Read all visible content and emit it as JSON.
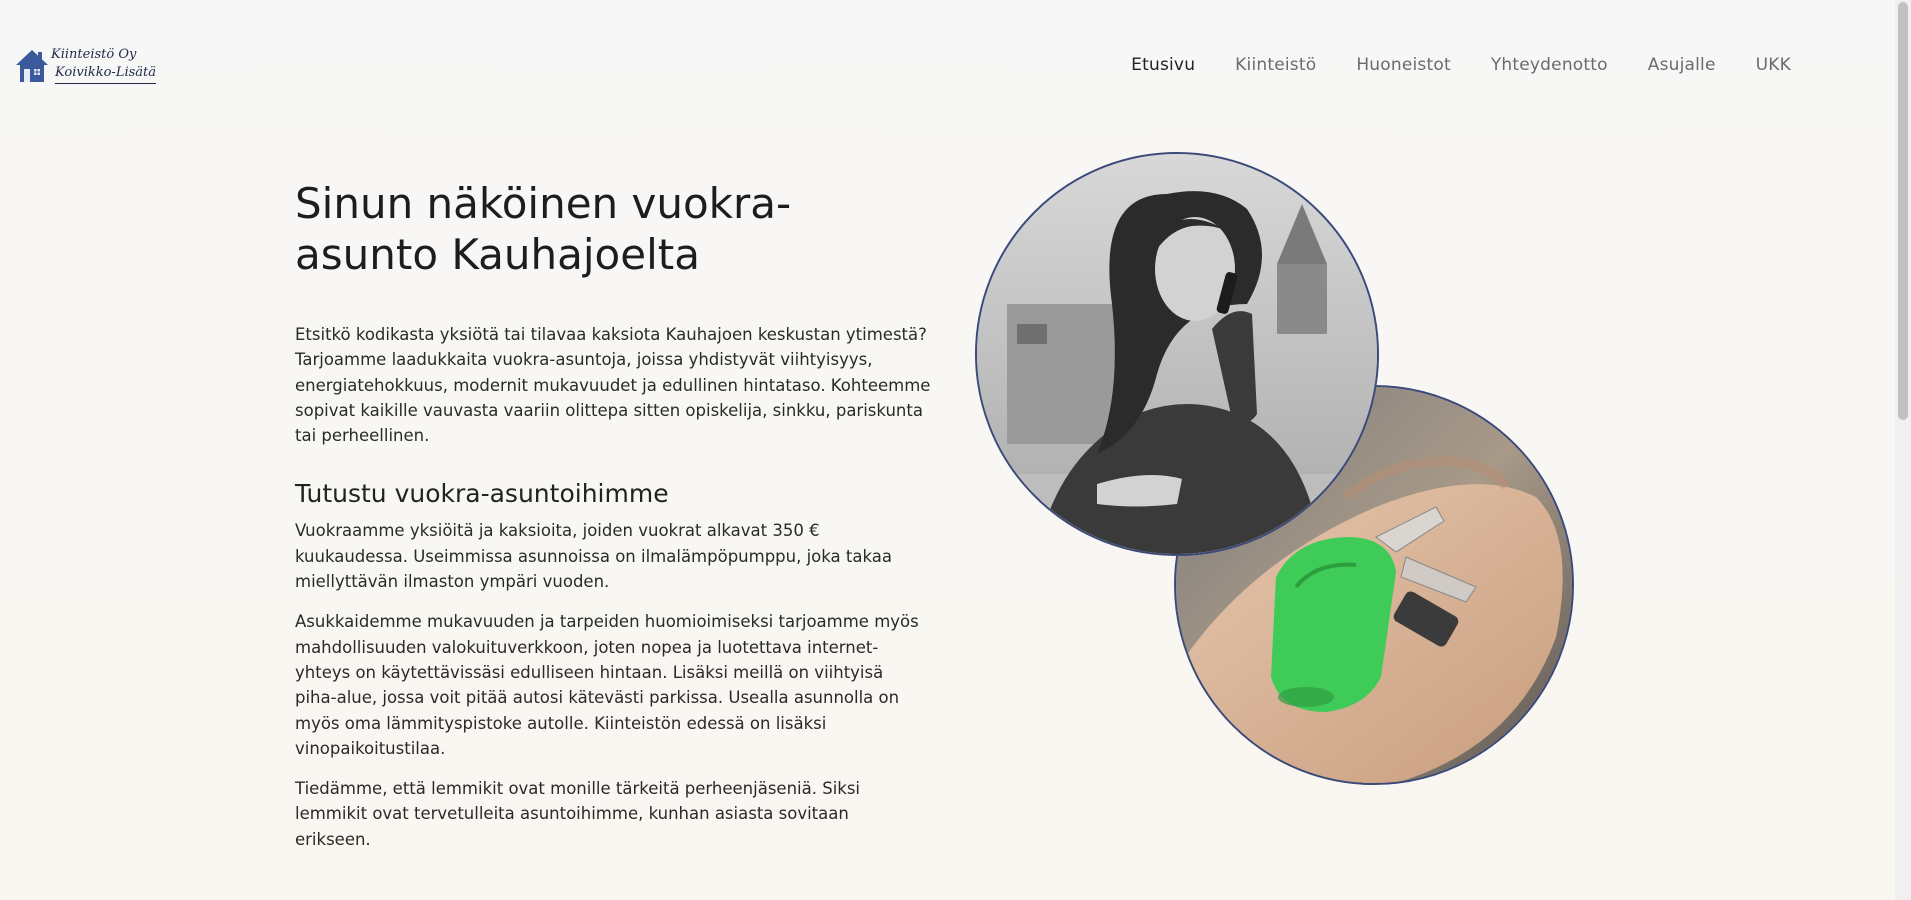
{
  "logo": {
    "line1": "Kiinteistö Oy",
    "line2": "Koivikko-Lisätä",
    "icon": "house-icon",
    "color": "#3a5a9b"
  },
  "nav": {
    "items": [
      {
        "label": "Etusivu",
        "active": true
      },
      {
        "label": "Kiinteistö"
      },
      {
        "label": "Huoneistot"
      },
      {
        "label": "Yhteydenotto"
      },
      {
        "label": "Asujalle"
      },
      {
        "label": "UKK"
      }
    ]
  },
  "main": {
    "title": "Sinun näköinen vuokra-asunto Kauhajoelta",
    "intro": "Etsitkö kodikasta yksiötä tai tilavaa kaksiota Kauhajoen keskustan ytimestä? Tarjoamme laadukkaita vuokra-asuntoja, joissa yhdistyvät viihtyisyys, energiatehokkuus, modernit mukavuudet ja edullinen hintataso. Kohteemme sopivat kaikille vauvasta vaariin olittepa sitten opiskelija, sinkku, pariskunta tai perheellinen.",
    "subtitle": "Tutustu vuokra-asuntoihimme",
    "paragraphs": [
      "Vuokraamme yksiöitä ja kaksioita, joiden vuokrat alkavat 350 € kuukaudessa. Useimmissa asunnoissa on ilmalämpöpumppu, joka takaa miellyttävän ilmaston ympäri vuoden.",
      "Asukkaidemme mukavuuden ja tarpeiden huomioimiseksi tarjoamme myös mahdollisuuden valokuituverkkoon, joten nopea ja luotettava internet-yhteys on käytettävissäsi edulliseen hintaan. Lisäksi meillä on viihtyisä piha-alue, jossa voit pitää autosi kätevästi parkissa. Usealla asunnolla on myös oma lämmityspistoke autolle. Kiinteistön edessä on lisäksi vinopaikoitustilaa.",
      "Tiedämme, että lemmikit ovat monille tärkeitä perheenjäseniä. Siksi lemmikit ovat tervetulleita asuntoihimme, kunhan asiasta sovitaan erikseen."
    ]
  },
  "images": {
    "woman_photo": "woman-on-phone-photo",
    "keys_photo": "keys-in-hand-photo"
  },
  "colors": {
    "accent": "#3b4a7a",
    "keychain": "#3ecb57"
  }
}
